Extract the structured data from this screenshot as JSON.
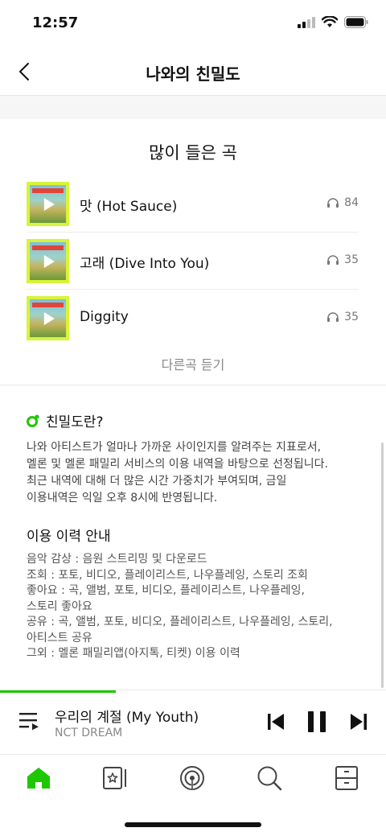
{
  "status_bar": {
    "time": "12:57"
  },
  "header": {
    "title": "나와의 친밀도"
  },
  "most_played": {
    "title": "많이 들은 곡",
    "songs": [
      {
        "title": "맛 (Hot Sauce)",
        "count": "84"
      },
      {
        "title": "고래 (Dive Into You)",
        "count": "35"
      },
      {
        "title": "Diggity",
        "count": "35"
      }
    ],
    "more_label": "다른곡 듣기"
  },
  "intimacy_info": {
    "title": "친밀도란?",
    "lines": [
      "나와 아티스트가 얼마나 가까운 사이인지를 알려주는 지표로서,",
      "멜론 및 멜론 패밀리 서비스의 이용 내역을 바탕으로 선정됩니다.",
      "최근 내역에 대해 더 많은 시간 가중치가 부여되며, 금일",
      "이용내역은 익일 오후 8시에 반영됩니다."
    ]
  },
  "usage_history": {
    "title": "이용 이력 안내",
    "lines": [
      "음악 감상 : 음원 스트리밍 및 다운로드",
      "조회 : 포토, 비디오, 플레이리스트, 나우플레잉, 스토리 조회",
      "좋아요 : 곡, 앨범, 포토, 비디오, 플레이리스트, 나우플레잉,",
      "스토리 좋아요",
      "공유 : 곡, 앨범, 포토, 비디오, 플레이리스트, 나우플레잉, 스토리,",
      "아티스트 공유",
      "그외 : 멜론 패밀리앱(아지톡, 티켓) 이용 이력"
    ]
  },
  "player": {
    "title": "우리의 계절 (My Youth)",
    "artist": "NCT DREAM",
    "progress": 0.3
  },
  "tab_bar": {
    "tabs": [
      {
        "icon": "home-icon",
        "active": true
      },
      {
        "icon": "library-icon",
        "active": false
      },
      {
        "icon": "podcast-icon",
        "active": false
      },
      {
        "icon": "search-icon",
        "active": false
      },
      {
        "icon": "drawer-icon",
        "active": false
      }
    ]
  },
  "colors": {
    "accent": "#1ec800",
    "album_border": "#d8f43a"
  }
}
